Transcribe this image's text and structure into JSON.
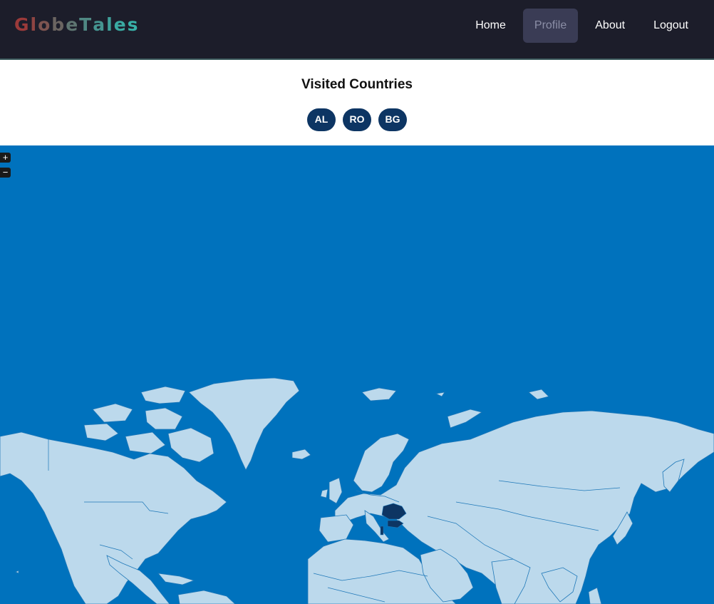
{
  "navbar": {
    "logo_letters": [
      {
        "ch": "G",
        "color": "#9b3a3a"
      },
      {
        "ch": "l",
        "color": "#8e4442"
      },
      {
        "ch": "o",
        "color": "#7d5450"
      },
      {
        "ch": "b",
        "color": "#6b6561"
      },
      {
        "ch": "e",
        "color": "#5e7571"
      },
      {
        "ch": "T",
        "color": "#4f8883"
      },
      {
        "ch": "a",
        "color": "#459490"
      },
      {
        "ch": "l",
        "color": "#3fa09a"
      },
      {
        "ch": "e",
        "color": "#3aaaa2"
      },
      {
        "ch": "s",
        "color": "#38b0a8"
      }
    ],
    "links": [
      {
        "label": "Home",
        "active": false
      },
      {
        "label": "Profile",
        "active": true
      },
      {
        "label": "About",
        "active": false
      },
      {
        "label": "Logout",
        "active": false
      }
    ]
  },
  "visited": {
    "title": "Visited Countries",
    "countries": [
      "AL",
      "RO",
      "BG"
    ]
  },
  "map": {
    "zoom_in_label": "+",
    "zoom_out_label": "−",
    "colors": {
      "ocean": "#0072bd",
      "land": "#bcd9ec",
      "visited": "#0d3563",
      "border": "#1f78b8"
    }
  }
}
